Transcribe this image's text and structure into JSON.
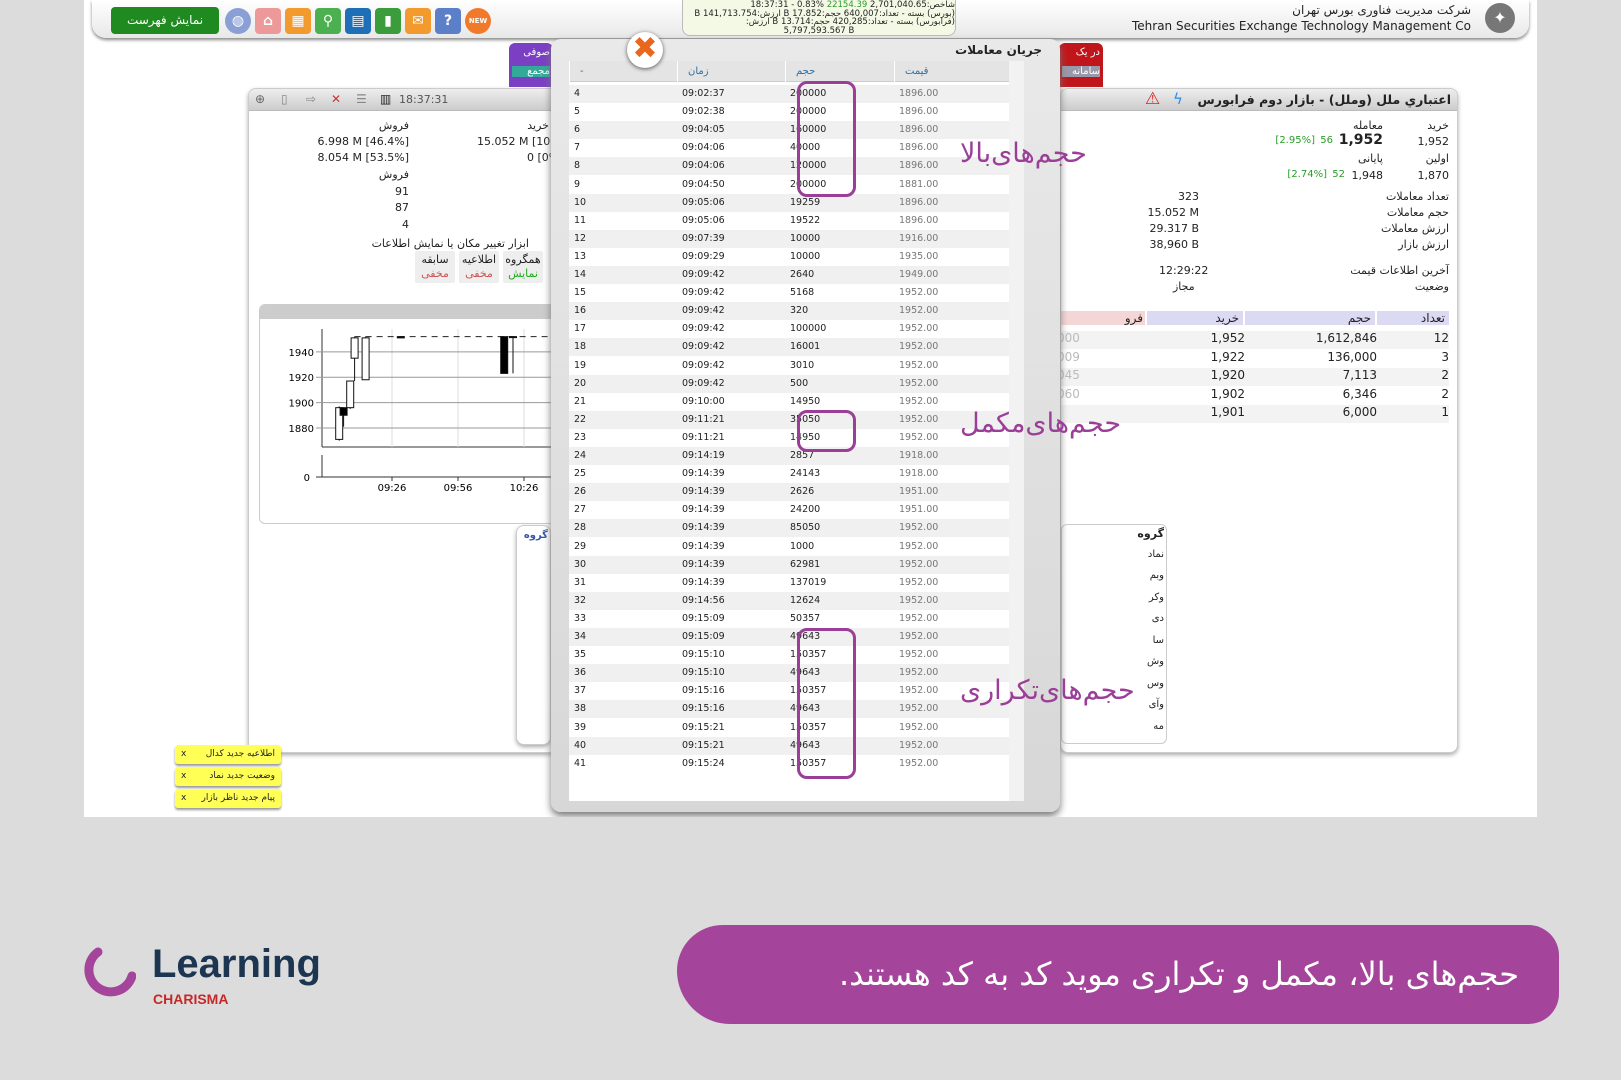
{
  "topbar": {
    "list_button": "نمایش فهرست",
    "icons": [
      "globe-icon",
      "home-icon",
      "table-icon",
      "search-icon",
      "book-icon",
      "chart-icon",
      "message-icon",
      "help-icon",
      "new-icon"
    ],
    "ticker": {
      "line1_a": "شاخص:2,701,040.65",
      "line1_change": "22154.39",
      "line1_b": "%0.83 - 18:37:31",
      "line2": "(بورس) بسته - تعداد:640,007 حجم:B 17.852 ارزش:B 141,713.754",
      "line3": "(فرابورس) بسته - تعداد:420,285 حجم:B 13.714 ارزش:",
      "line4": "5,797,593.567 B"
    },
    "brand_fa": "شرکت مدیریت فناوری بورس تهران",
    "brand_en": "Tehran Securities Exchange Technology Management Co"
  },
  "tabs": {
    "purple_top": "صوفی",
    "purple_bottom": "مجمع",
    "red_top": "در یک",
    "red_bottom": "سامانه"
  },
  "left_panel": {
    "time": "18:37:31",
    "sell_label": "فروش",
    "buy_label": "خرید",
    "sell_vals": [
      "6.998 M [46.4%]",
      "8.054 M [53.5%]"
    ],
    "buy_vals": [
      "15.052 M [100%]",
      "0 [0%]"
    ],
    "sell_label2": "فروش",
    "buy_label2": "خرید",
    "sell_counts": [
      "91",
      "87",
      "4"
    ],
    "tools_title": "ابزار تغییر مکان یا نمایش اطلاعات",
    "tools": [
      {
        "name": "سابقه",
        "state": "مخفی"
      },
      {
        "name": "اطلاعیه",
        "state": "مخفی"
      },
      {
        "name": "همگروه",
        "state": "نمایش"
      }
    ]
  },
  "chart_data": {
    "type": "candlestick",
    "y_ticks": [
      1880,
      1900,
      1920,
      1940
    ],
    "volume_ticks": [
      0
    ],
    "x_ticks": [
      "09:26",
      "09:56",
      "10:26"
    ],
    "ylim": [
      1865,
      1958
    ],
    "candles": [
      {
        "t": "09:02",
        "o": 1871,
        "h": 1897,
        "l": 1870,
        "c": 1896
      },
      {
        "t": "09:04",
        "o": 1896,
        "h": 1896,
        "l": 1881,
        "c": 1890
      },
      {
        "t": "09:07",
        "o": 1896,
        "h": 1917,
        "l": 1895,
        "c": 1917
      },
      {
        "t": "09:09",
        "o": 1935,
        "h": 1952,
        "l": 1917,
        "c": 1951
      },
      {
        "t": "09:14",
        "o": 1918,
        "h": 1952,
        "l": 1918,
        "c": 1951
      },
      {
        "t": "09:30",
        "o": 1952,
        "h": 1952,
        "l": 1951,
        "c": 1951
      },
      {
        "t": "10:17",
        "o": 1952,
        "h": 1952,
        "l": 1923,
        "c": 1923
      },
      {
        "t": "10:21",
        "o": 1952,
        "h": 1952,
        "l": 1923,
        "c": 1952
      }
    ],
    "ref_price": 1952
  },
  "right_panel": {
    "title": "اعتباري ملل (وملل) - بازار دوم فرابورس",
    "buy_label": "خرید",
    "buy_val": "1,952",
    "trade_label": "معامله",
    "trade_val": "1,952",
    "trade_change": "56",
    "trade_pct": "[2.95%]",
    "first_label": "اولین",
    "first_val": "1,870",
    "last_label": "پایانی",
    "last_val": "1,948",
    "last_change": "52",
    "last_pct": "[2.74%]",
    "stats": [
      {
        "label": "تعداد معاملات",
        "value": "323"
      },
      {
        "label": "حجم معاملات",
        "value": "15.052 M"
      },
      {
        "label": "ارزش معاملات",
        "value": "29.317 B"
      },
      {
        "label": "ارزش بازار",
        "value": "38,960 B"
      }
    ],
    "last_info_label": "آخرین اطلاعات قیمت",
    "last_info_val": "12:29:22",
    "status_label": "وضعیت",
    "status_val": "مجاز",
    "order_head": {
      "count": "تعداد",
      "volume": "حجم",
      "buy": "خرید",
      "sell": "فرو"
    },
    "orders": [
      [
        "12",
        "1,612,846",
        "1,952",
        "000"
      ],
      [
        "3",
        "136,000",
        "1,922",
        "009"
      ],
      [
        "2",
        "7,113",
        "1,920",
        "045"
      ],
      [
        "2",
        "6,346",
        "1,902",
        "060"
      ],
      [
        "1",
        "6,000",
        "1,901",
        ""
      ]
    ],
    "group_items": [
      "گروه",
      "نماد",
      "وبم",
      "وکر",
      "دی",
      "سا",
      "وش",
      "وس",
      "وآی",
      "مه"
    ],
    "left_group": "گروه"
  },
  "modal": {
    "title": "جریان معاملات",
    "headers": {
      "num": "-",
      "time": "زمان",
      "volume": "حجم",
      "price": "قیمت"
    },
    "trades": [
      [
        "4",
        "09:02:37",
        "200000",
        "1896.00"
      ],
      [
        "5",
        "09:02:38",
        "200000",
        "1896.00"
      ],
      [
        "6",
        "09:04:05",
        "160000",
        "1896.00"
      ],
      [
        "7",
        "09:04:06",
        "40000",
        "1896.00"
      ],
      [
        "8",
        "09:04:06",
        "120000",
        "1896.00"
      ],
      [
        "9",
        "09:04:50",
        "200000",
        "1881.00"
      ],
      [
        "10",
        "09:05:06",
        "19259",
        "1896.00"
      ],
      [
        "11",
        "09:05:06",
        "19522",
        "1896.00"
      ],
      [
        "12",
        "09:07:39",
        "10000",
        "1916.00"
      ],
      [
        "13",
        "09:09:29",
        "10000",
        "1935.00"
      ],
      [
        "14",
        "09:09:42",
        "2640",
        "1949.00"
      ],
      [
        "15",
        "09:09:42",
        "5168",
        "1952.00"
      ],
      [
        "16",
        "09:09:42",
        "320",
        "1952.00"
      ],
      [
        "17",
        "09:09:42",
        "100000",
        "1952.00"
      ],
      [
        "18",
        "09:09:42",
        "16001",
        "1952.00"
      ],
      [
        "19",
        "09:09:42",
        "3010",
        "1952.00"
      ],
      [
        "20",
        "09:09:42",
        "500",
        "1952.00"
      ],
      [
        "21",
        "09:10:00",
        "14950",
        "1952.00"
      ],
      [
        "22",
        "09:11:21",
        "35050",
        "1952.00"
      ],
      [
        "23",
        "09:11:21",
        "14950",
        "1952.00"
      ],
      [
        "24",
        "09:14:19",
        "2857",
        "1918.00"
      ],
      [
        "25",
        "09:14:39",
        "24143",
        "1918.00"
      ],
      [
        "26",
        "09:14:39",
        "2626",
        "1951.00"
      ],
      [
        "27",
        "09:14:39",
        "24200",
        "1951.00"
      ],
      [
        "28",
        "09:14:39",
        "85050",
        "1952.00"
      ],
      [
        "29",
        "09:14:39",
        "1000",
        "1952.00"
      ],
      [
        "30",
        "09:14:39",
        "62981",
        "1952.00"
      ],
      [
        "31",
        "09:14:39",
        "137019",
        "1952.00"
      ],
      [
        "32",
        "09:14:56",
        "12624",
        "1952.00"
      ],
      [
        "33",
        "09:15:09",
        "50357",
        "1952.00"
      ],
      [
        "34",
        "09:15:09",
        "49643",
        "1952.00"
      ],
      [
        "35",
        "09:15:10",
        "150357",
        "1952.00"
      ],
      [
        "36",
        "09:15:10",
        "49643",
        "1952.00"
      ],
      [
        "37",
        "09:15:16",
        "150357",
        "1952.00"
      ],
      [
        "38",
        "09:15:16",
        "49643",
        "1952.00"
      ],
      [
        "39",
        "09:15:21",
        "150357",
        "1952.00"
      ],
      [
        "40",
        "09:15:21",
        "49643",
        "1952.00"
      ],
      [
        "41",
        "09:15:24",
        "150357",
        "1952.00"
      ]
    ]
  },
  "annotations": {
    "high": "حجم‌های‌بالا",
    "complement": "حجم‌های‌مکمل",
    "repeat": "حجم‌های‌تکراری",
    "color": "#9b3e98"
  },
  "notifications": [
    "اطلاعیه جدید کدال",
    "وضعیت جدید نماد",
    "پیام جدید ناظر بازار"
  ],
  "notification_close": "x",
  "banner": "حجم‌های بالا، مکمل و تکراری موید کد به کد هستند.",
  "logo": {
    "word": "Learning",
    "sub": "CHARISMA"
  },
  "colors": {
    "accent": "#a4449a",
    "up": "#2a9d2a",
    "list_button": "#1f8a1f"
  }
}
